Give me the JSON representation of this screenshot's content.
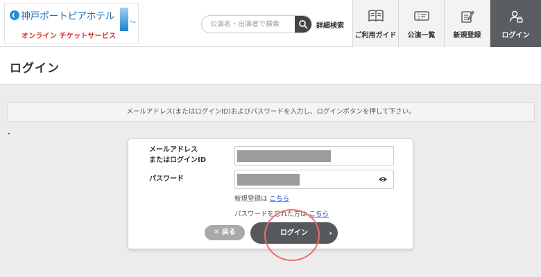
{
  "header": {
    "logo": {
      "name": "神戸ポートピアホテル",
      "subtitle": "オンライン チケットサービス"
    },
    "search": {
      "placeholder": "公演名・出演者で検索",
      "value": ""
    },
    "advanced_search_label": "詳細検索",
    "nav": [
      {
        "label": "ご利用ガイド",
        "icon": "book-icon",
        "active": false
      },
      {
        "label": "公演一覧",
        "icon": "ticket-icon",
        "active": false
      },
      {
        "label": "新規登録",
        "icon": "edit-icon",
        "active": false
      },
      {
        "label": "ログイン",
        "icon": "user-icon",
        "active": true
      }
    ]
  },
  "page_title": "ログイン",
  "notice": "メールアドレス(またはログインID)およびパスワードを入力し、ログインボタンを押して下さい。",
  "form": {
    "email_label_line1": "メールアドレス",
    "email_label_line2": "またはログインID",
    "password_label": "パスワード",
    "register_prefix": "新規登録は",
    "register_link": "こちら",
    "forgot_prefix": "パスワードを忘れた方は",
    "forgot_link": "こちら",
    "back_button": "✕ 戻る",
    "login_button": "ログイン",
    "login_chevron": "›"
  },
  "colors": {
    "accent": "#55595d",
    "active_nav": "#5a5e62",
    "link": "#1e4fcf",
    "highlight": "#ef6b6b",
    "logo_red": "#d8261c",
    "logo_blue": "#1e6fb5"
  }
}
